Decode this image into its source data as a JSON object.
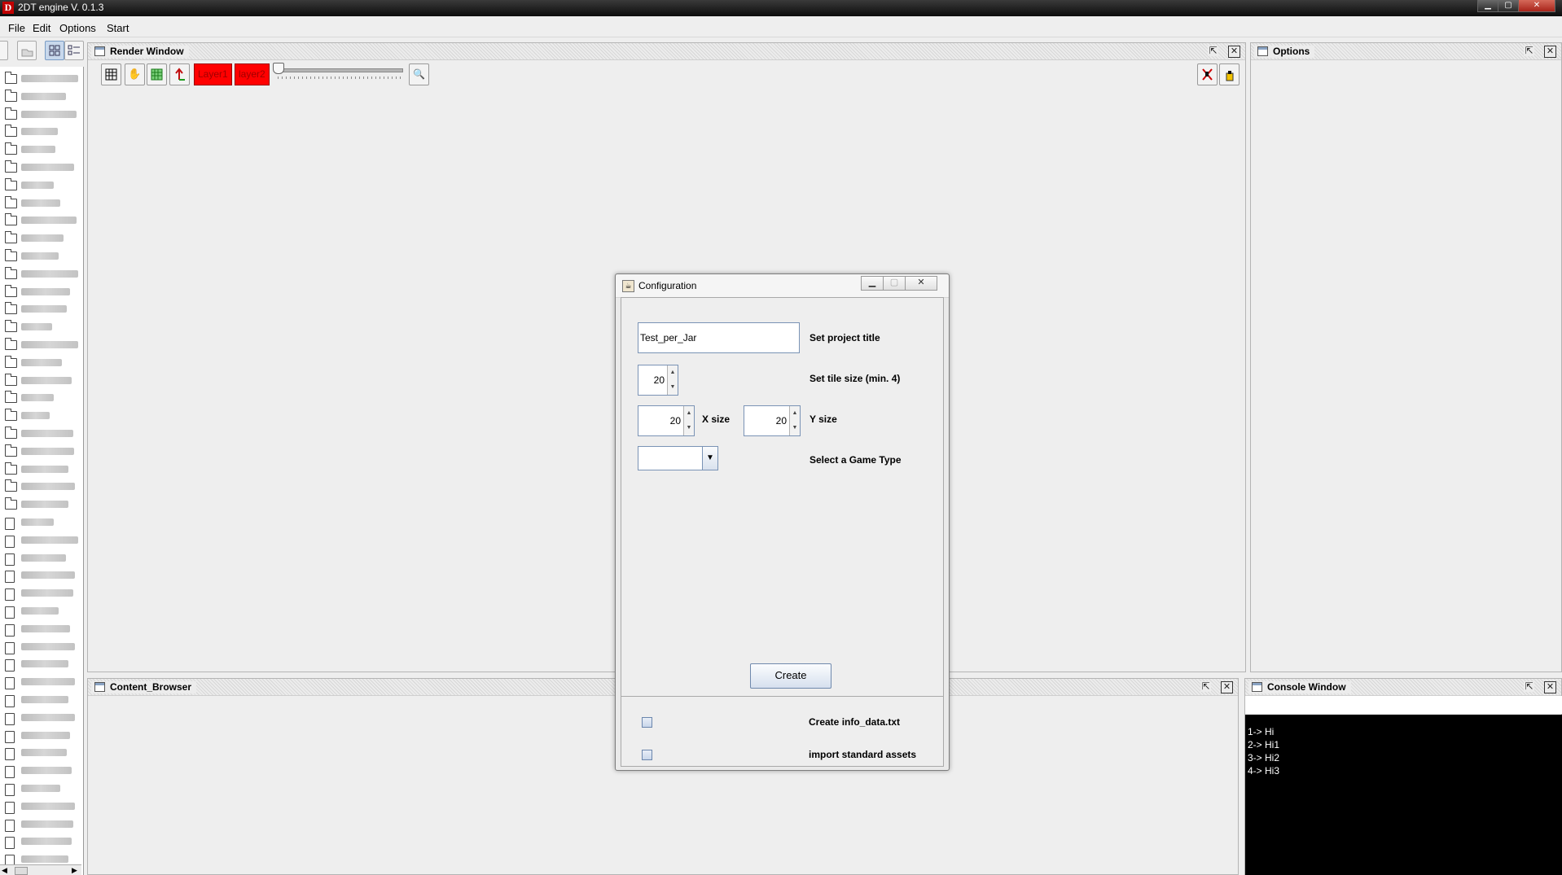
{
  "app": {
    "title": "2DT engine V. 0.1.3",
    "logo_letter": "D",
    "window_controls": [
      "minimize",
      "maximize",
      "close"
    ]
  },
  "menu": [
    "File",
    "Edit",
    "Options",
    "Start"
  ],
  "render_window": {
    "title": "Render Window",
    "toolbar": {
      "layers": [
        "Layer1",
        "layer2"
      ],
      "slider_value": 0
    }
  },
  "options_window": {
    "title": "Options"
  },
  "content_browser": {
    "title": "Content_Browser"
  },
  "console": {
    "title": "Console Window",
    "lines": [
      "1-> Hi",
      "2-> Hi1",
      "3-> Hi2",
      "4-> Hi3"
    ]
  },
  "dialog": {
    "title": "Configuration",
    "project_title_value": "Test_per_Jar",
    "project_title_label": "Set project title",
    "tile_size_value": "20",
    "tile_size_label": "Set tile size (min. 4)",
    "x_size_value": "20",
    "x_size_label": "X size",
    "y_size_value": "20",
    "y_size_label": "Y size",
    "game_type_value": "",
    "game_type_label": "Select a Game Type",
    "create_button": "Create",
    "info_data_label": "Create info_data.txt",
    "info_data_checked": false,
    "import_assets_label": "import standard assets",
    "import_assets_checked": false
  },
  "colors": {
    "layer_button": "#ff0000",
    "console_bg": "#000000",
    "console_text": "#ffffff",
    "background": "#eeeeee"
  }
}
